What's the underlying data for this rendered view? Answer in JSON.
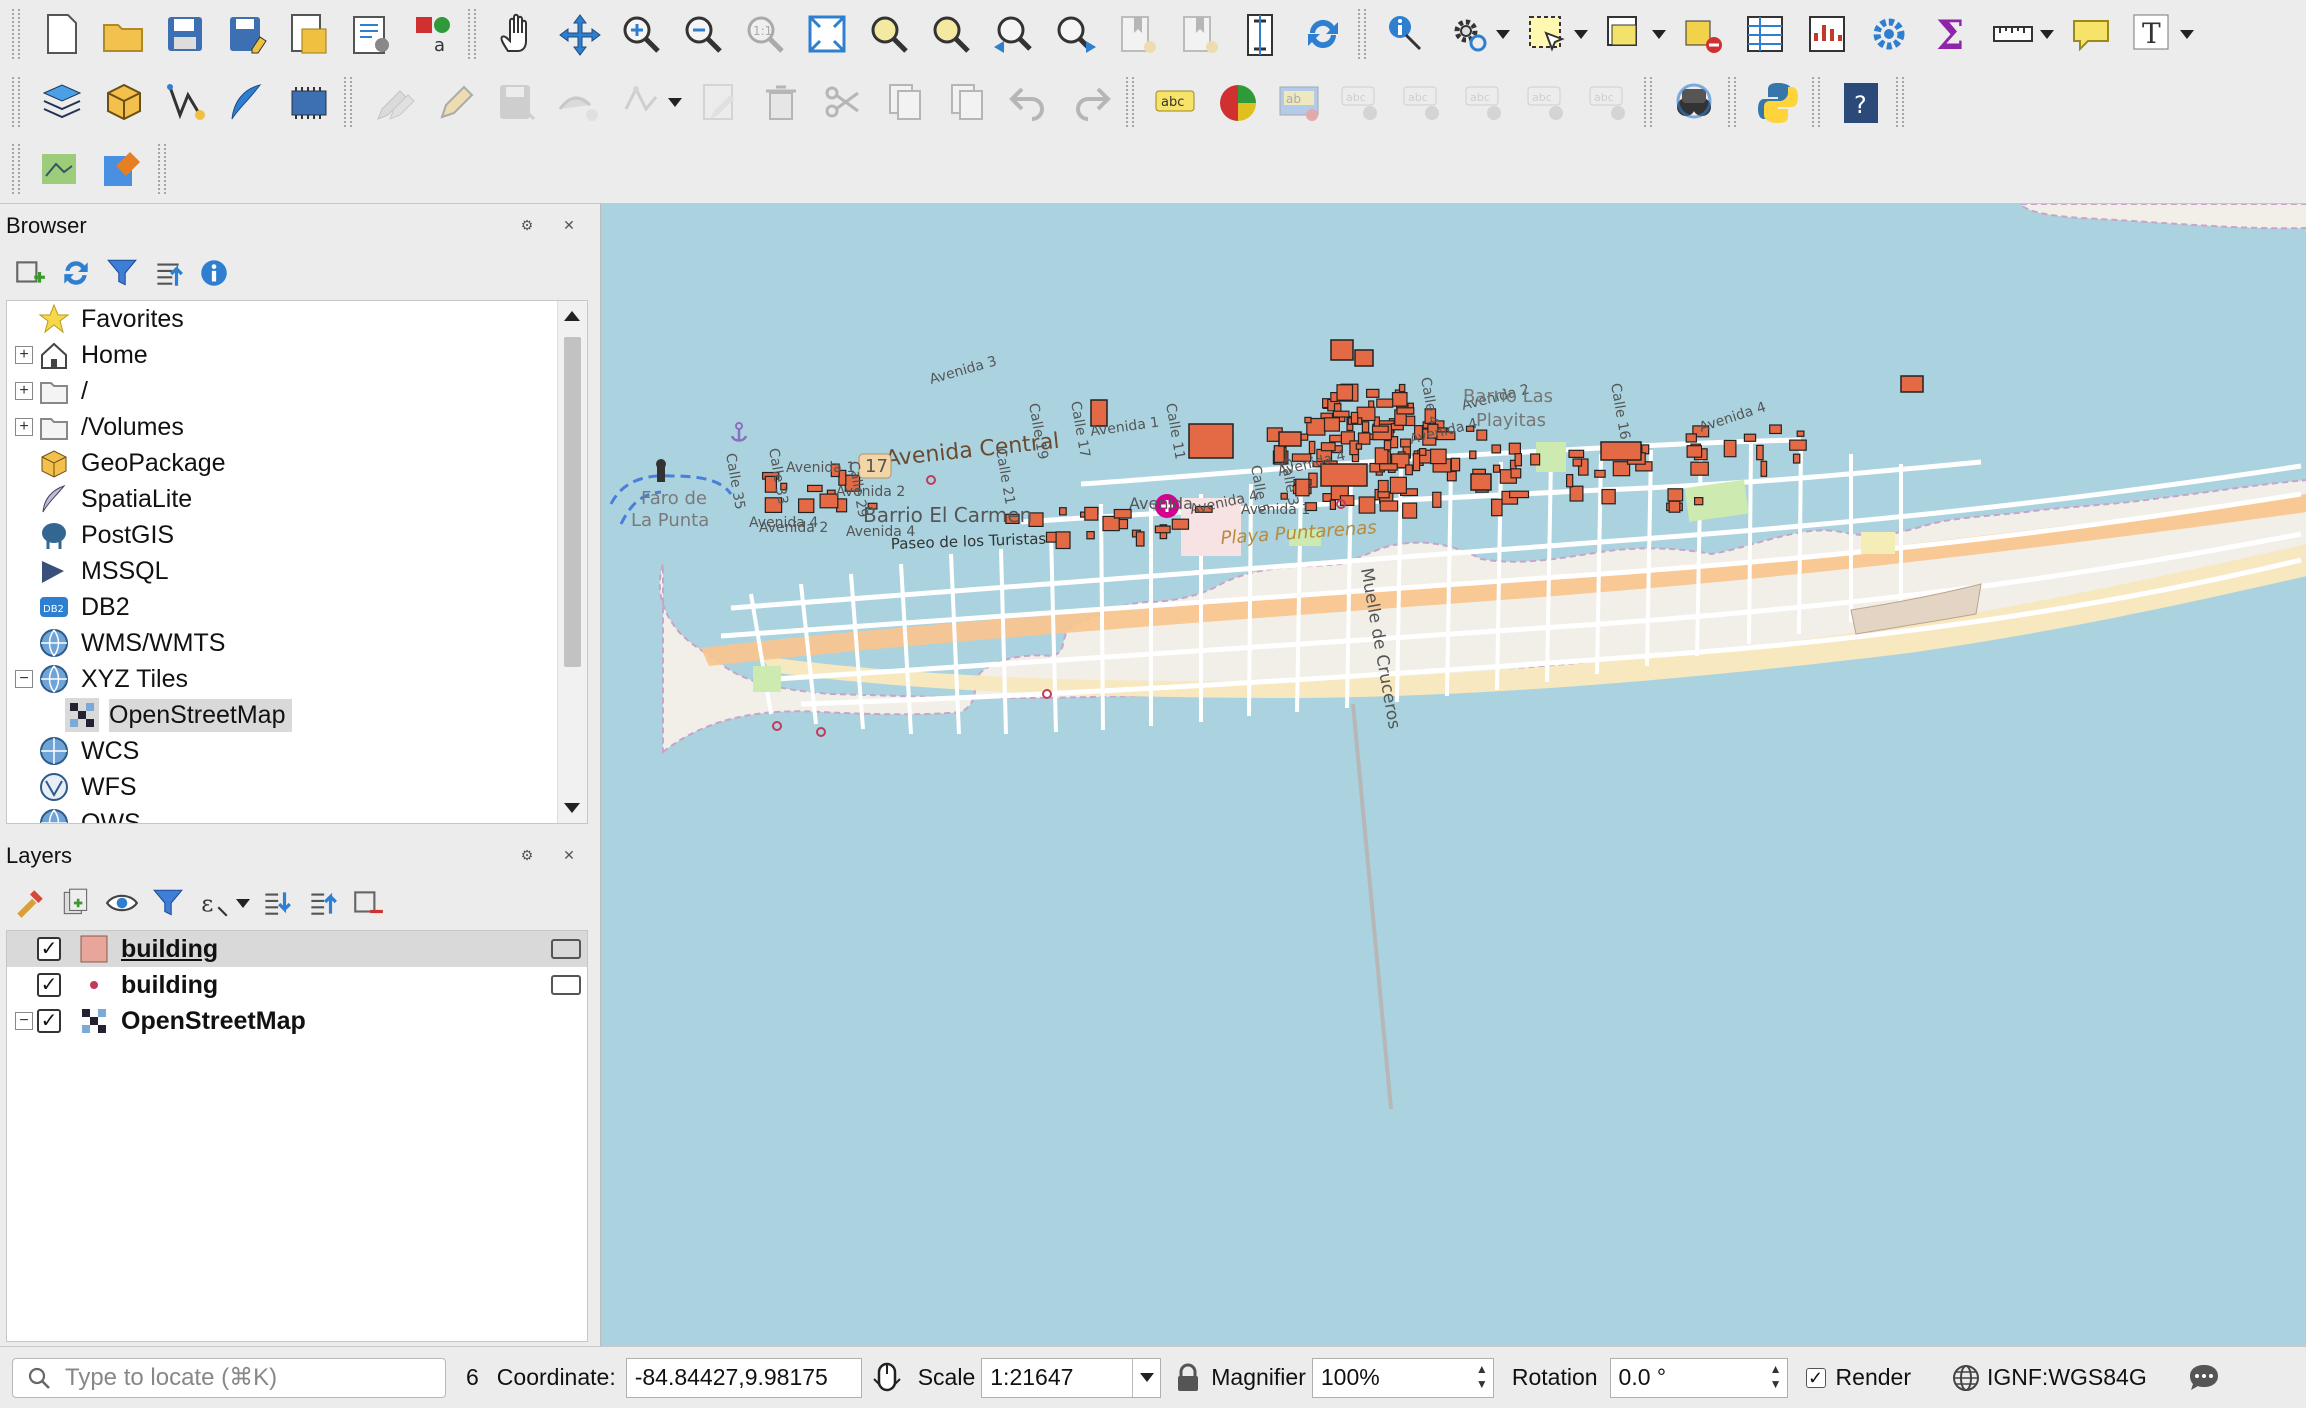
{
  "toolbar": {
    "row1": [
      "new-project-icon",
      "open-project-icon",
      "save-project-icon",
      "save-as-icon",
      "print-layout-icon",
      "layout-manager-icon",
      "style-manager-icon",
      "pan-hand-icon",
      "pan-to-selection-icon",
      "zoom-in-icon",
      "zoom-out-icon",
      "zoom-native-icon",
      "zoom-full-icon",
      "zoom-selection-icon",
      "zoom-layer-icon",
      "zoom-last-icon",
      "zoom-next-icon",
      "new-bookmark-icon",
      "show-bookmarks-icon",
      "temporal-icon",
      "refresh-icon",
      "identify-icon",
      "run-action-icon",
      "select-features-icon",
      "select-by-value-icon",
      "deselect-icon",
      "attribute-table-icon",
      "statistics-icon",
      "processing-toolbox-icon",
      "sum-icon",
      "measure-icon",
      "annotation-icon",
      "text-annotation-icon"
    ],
    "row2": [
      "data-source-manager-icon",
      "new-geopackage-icon",
      "new-shapefile-icon",
      "new-spatialite-icon",
      "new-temp-layer-icon",
      "current-edits-icon",
      "toggle-editing-icon",
      "save-edits-icon",
      "digitize-icon",
      "vertex-tool-icon",
      "modify-attributes-icon",
      "delete-selected-icon",
      "cut-features-icon",
      "copy-features-icon",
      "paste-features-icon",
      "undo-icon",
      "redo-icon",
      "label-tool-icon",
      "diagram-tool-icon",
      "pin-labels-icon",
      "show-hide-labels-icon",
      "move-label-icon",
      "rotate-label-icon",
      "change-label-icon",
      "label-properties-icon",
      "quickosm-icon",
      "python-console-icon",
      "help-icon"
    ],
    "row3": [
      "georeferencer-icon",
      "plugin-tool-icon"
    ]
  },
  "browser": {
    "title": "Browser",
    "items": [
      {
        "label": "Favorites",
        "icon": "star-icon",
        "expander": ""
      },
      {
        "label": "Home",
        "icon": "home-icon",
        "expander": "+"
      },
      {
        "label": "/",
        "icon": "folder-icon",
        "expander": "+"
      },
      {
        "label": "/Volumes",
        "icon": "folder-icon",
        "expander": "+"
      },
      {
        "label": "GeoPackage",
        "icon": "geopackage-icon",
        "expander": ""
      },
      {
        "label": "SpatiaLite",
        "icon": "spatialite-icon",
        "expander": ""
      },
      {
        "label": "PostGIS",
        "icon": "postgis-icon",
        "expander": ""
      },
      {
        "label": "MSSQL",
        "icon": "mssql-icon",
        "expander": ""
      },
      {
        "label": "DB2",
        "icon": "db2-icon",
        "expander": ""
      },
      {
        "label": "WMS/WMTS",
        "icon": "globe-icon",
        "expander": ""
      },
      {
        "label": "XYZ Tiles",
        "icon": "globe-icon",
        "expander": "−"
      },
      {
        "label": "OpenStreetMap",
        "icon": "xyz-tile-icon",
        "expander": "",
        "child": true,
        "selected": true
      },
      {
        "label": "WCS",
        "icon": "wcs-icon",
        "expander": ""
      },
      {
        "label": "WFS",
        "icon": "wfs-icon",
        "expander": ""
      },
      {
        "label": "OWS",
        "icon": "globe-icon",
        "expander": ""
      }
    ]
  },
  "layers": {
    "title": "Layers",
    "items": [
      {
        "label": "building",
        "symbol": "polygon",
        "color": "#e8a59a",
        "checked": true,
        "underline": true,
        "selected": true,
        "editing": true
      },
      {
        "label": "building",
        "symbol": "point",
        "color": "#c23a5a",
        "checked": true,
        "underline": false,
        "selected": false,
        "editing": true
      },
      {
        "label": "OpenStreetMap",
        "symbol": "xyz",
        "color": "#334",
        "checked": true,
        "underline": false,
        "selected": false,
        "editing": false,
        "expander": "−"
      }
    ]
  },
  "map": {
    "labels": {
      "barrio_el_carmen": "Barrio El Carmen",
      "avenida_central": "Avenida Central",
      "avenida_1a": "Avenida 1",
      "avenida_1b": "Avenida 1",
      "avenida_1c": "Avenida 1",
      "avenida_2a": "Avenida 2",
      "avenida_2b": "Avenida 2",
      "avenida_2c": "Avenida 2",
      "avenida_3": "Avenida 3",
      "avenida_4a": "Avenida 4",
      "avenida_4b": "Avenida 4",
      "avenida_4c": "Avenida 4",
      "avenida_4d": "Avenida 4",
      "avenida_4e": "Avenida 4",
      "avenida_4f": "Avenida 4",
      "avenida_e": "Avenida",
      "route_17": "17",
      "calle_35": "Calle 35",
      "calle_33": "Calle 33",
      "calle_29": "Calle 29",
      "calle_21": "Calle 21",
      "calle_19": "Calle 19",
      "calle_17": "Calle 17",
      "calle_11": "Calle 11",
      "calle_3": "Calle 3",
      "calle_5": "Calle 5",
      "calle_4": "Calle 4",
      "calle_16": "Calle 16",
      "faro": "Faro de",
      "la_punta": "La Punta",
      "paseo": "Paseo de los Turistas",
      "playa": "Playa Puntarenas",
      "muelle": "Muelle de Cruceros",
      "barrio_las_playitas_1": "Barrio Las",
      "barrio_las_playitas_2": "Playitas"
    }
  },
  "statusbar": {
    "locate_placeholder": "Type to locate (⌘K)",
    "message_count": "6",
    "coordinate_label": "Coordinate:",
    "coordinate_value": "-84.84427,9.98175",
    "scale_label": "Scale",
    "scale_value": "1:21647",
    "magnifier_label": "Magnifier",
    "magnifier_value": "100%",
    "rotation_label": "Rotation",
    "rotation_value": "0.0 °",
    "render_label": "Render",
    "render_checked": true,
    "crs_label": "IGNF:WGS84G"
  }
}
